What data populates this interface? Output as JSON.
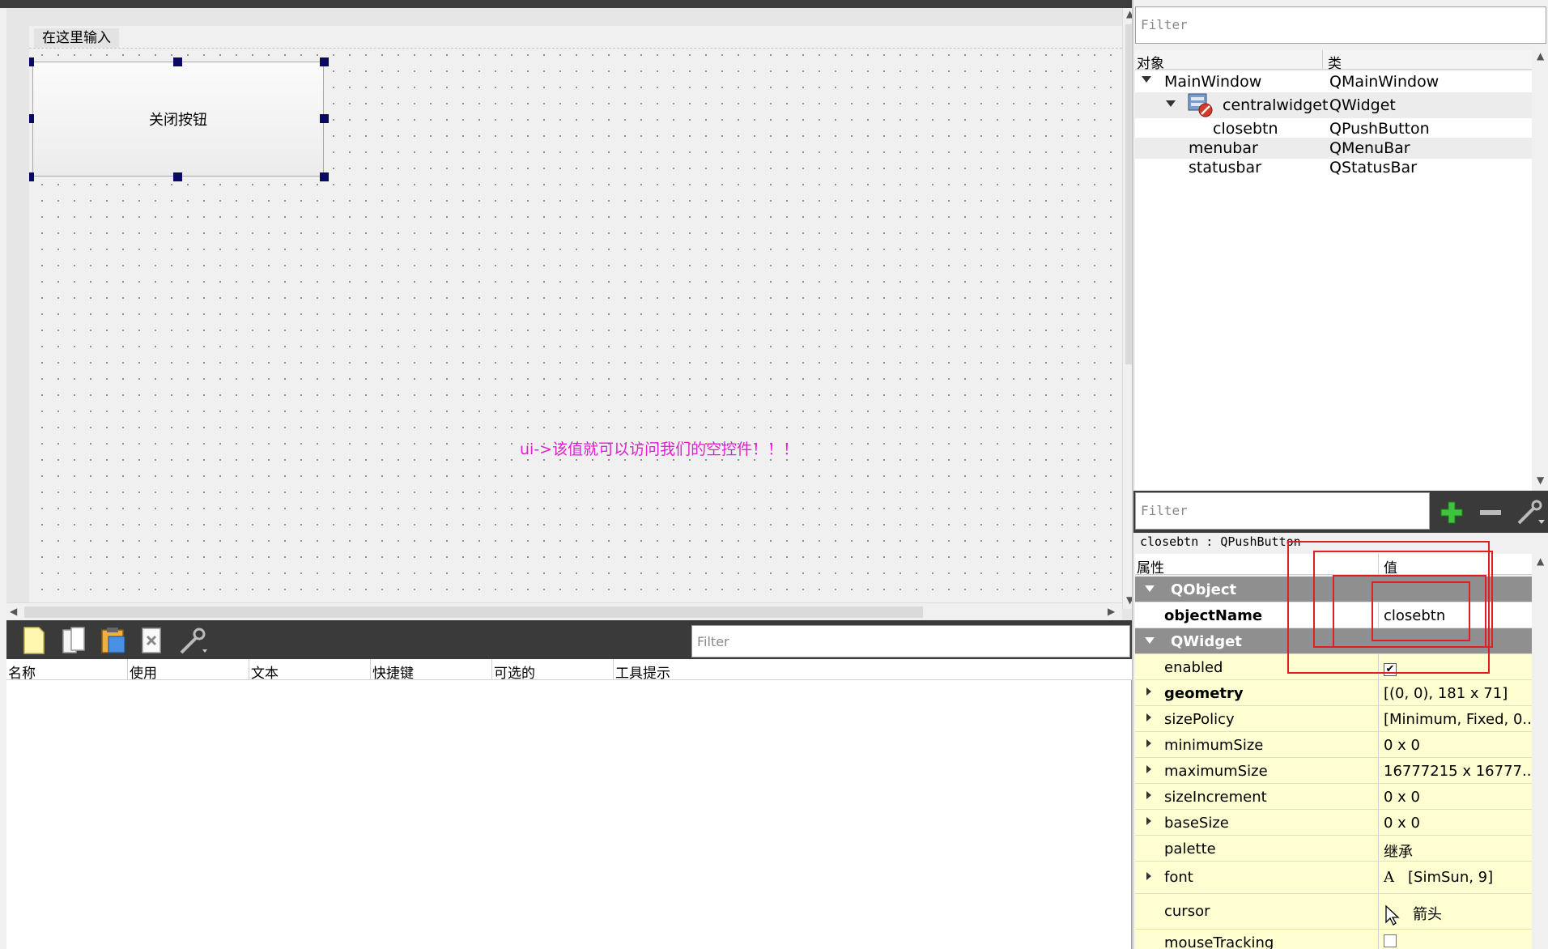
{
  "designer": {
    "menu_placeholder": "在这里输入",
    "button_text": "关闭按钮",
    "annotation": "ui->该值就可以访问我们的空控件！！！"
  },
  "action_editor": {
    "filter_placeholder": "Filter",
    "columns": [
      "名称",
      "使用",
      "文本",
      "快捷键",
      "可选的",
      "工具提示"
    ],
    "tool_icons": [
      "new-action-icon",
      "copy-action-icon",
      "paste-action-icon",
      "delete-action-icon",
      "configure-icon"
    ]
  },
  "object_inspector": {
    "filter_placeholder": "Filter",
    "header": {
      "object": "对象",
      "class": "类"
    },
    "items": [
      {
        "name": "MainWindow",
        "class": "QMainWindow"
      },
      {
        "name": "centralwidget",
        "class": "QWidget"
      },
      {
        "name": "closebtn",
        "class": "QPushButton"
      },
      {
        "name": "menubar",
        "class": "QMenuBar"
      },
      {
        "name": "statusbar",
        "class": "QStatusBar"
      }
    ]
  },
  "property_editor": {
    "filter_placeholder": "Filter",
    "class_label": "closebtn : QPushButton",
    "header": {
      "property": "属性",
      "value": "值"
    },
    "rows": [
      {
        "name": "QObject",
        "value": ""
      },
      {
        "name": "objectName",
        "value": "closebtn"
      },
      {
        "name": "QWidget",
        "value": ""
      },
      {
        "name": "enabled",
        "value": "✔"
      },
      {
        "name": "geometry",
        "value": "[(0, 0), 181 x 71]"
      },
      {
        "name": "sizePolicy",
        "value": "[Minimum, Fixed, 0..."
      },
      {
        "name": "minimumSize",
        "value": "0 x 0"
      },
      {
        "name": "maximumSize",
        "value": "16777215 x 16777..."
      },
      {
        "name": "sizeIncrement",
        "value": "0 x 0"
      },
      {
        "name": "baseSize",
        "value": "0 x 0"
      },
      {
        "name": "palette",
        "value": "继承"
      },
      {
        "name": "font",
        "value": "[SimSun, 9]"
      },
      {
        "name": "cursor",
        "value": "箭头"
      },
      {
        "name": "mouseTracking",
        "value": ""
      }
    ]
  },
  "colors": {
    "annotation": "#e020d0",
    "selection_handle": "#0a0a64",
    "highlight_box": "#e02020",
    "group_row": "#8f8f8f",
    "property_row": "#fffed0"
  }
}
